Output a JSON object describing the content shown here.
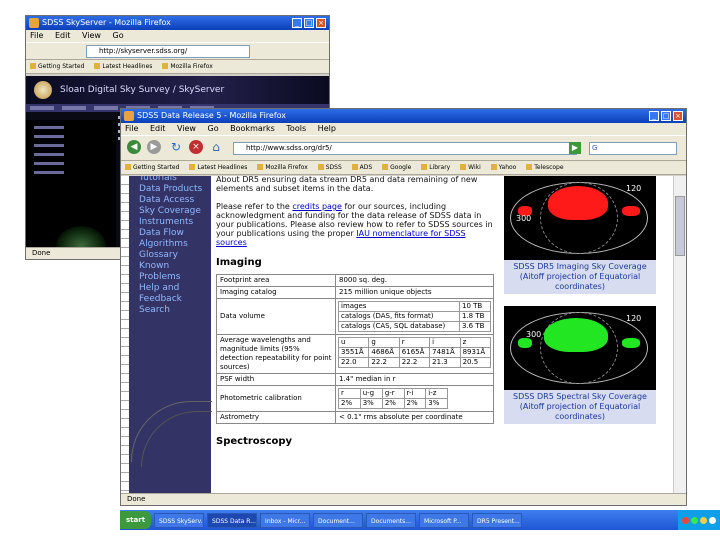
{
  "window_back": {
    "title": "SDSS SkyServer - Mozilla Firefox",
    "address": "http://skyserver.sdss.org/",
    "banner": "Sloan Digital Sky Survey / SkyServer"
  },
  "window_front": {
    "title": "SDSS Data Release 5 - Mozilla Firefox",
    "menu": [
      "File",
      "Edit",
      "View",
      "Go",
      "Bookmarks",
      "Tools",
      "Help"
    ],
    "address": "http://www.sdss.org/dr5/",
    "bookmarks": [
      "Getting Started",
      "Latest Headlines",
      "Mozilla Firefox",
      "SDSS",
      "ADS",
      "Google",
      "Library",
      "Wiki",
      "Yahoo",
      "Telescope"
    ],
    "status": "Done",
    "nav": [
      "Tutorials",
      "Data Products",
      "Data Access",
      "Sky Coverage",
      "Instruments",
      "Data Flow",
      "Algorithms",
      "Glossary",
      "Known Problems",
      "Help and Feedback",
      "Search"
    ],
    "intro_lines": [
      "About DR5 ensuring data stream DR5 and data remaining of new",
      "elements and subset items in the data."
    ],
    "credit_lines": [
      "Please refer to the",
      "credits page",
      "for our sources, including acknowledgment",
      "and funding for the data release of SDSS data in your",
      "publications. Please also review how to refer to SDSS sources in your",
      "publications using the proper",
      "IAU nomenclature for SDSS sources"
    ],
    "imaging_heading": "Imaging",
    "imaging_table": {
      "footprint_label": "Footprint area",
      "footprint_value": "8000 sq. deg.",
      "catalog_label": "Imaging catalog",
      "catalog_value": "215 million unique objects",
      "volume_label": "Data volume",
      "volume_rows": [
        {
          "name": "images",
          "value": "10 TB"
        },
        {
          "name": "catalogs (DAS, fits format)",
          "value": "1.8 TB"
        },
        {
          "name": "catalogs (CAS, SQL database)",
          "value": "3.6 TB"
        }
      ],
      "wavelength_label": "Average wavelengths and magnitude limits (95% detection repeatability for point sources)",
      "bands": [
        "u",
        "g",
        "r",
        "i",
        "z"
      ],
      "wavelengths": [
        "3551Å",
        "4686Å",
        "6165Å",
        "7481Å",
        "8931Å"
      ],
      "limits": [
        "22.0",
        "22.2",
        "22.2",
        "21.3",
        "20.5"
      ],
      "psf_label": "PSF width",
      "psf_value": "1.4\" median in r",
      "photometric_label": "Photometric calibration",
      "photometric_bands": [
        "r",
        "u-g",
        "g-r",
        "r-i",
        "i-z"
      ],
      "photometric_values": [
        "2%",
        "3%",
        "2%",
        "2%",
        "3%"
      ],
      "astrometry_label": "Astrometry",
      "astrometry_value": "< 0.1\" rms absolute per coordinate"
    },
    "spectroscopy_heading": "Spectroscopy",
    "caption_imaging": "SDSS DR5 Imaging Sky Coverage (Aitoff projection of Equatorial coordinates)",
    "caption_spectral": "SDSS DR5 Spectral Sky Coverage (Aitoff projection of Equatorial coordinates)",
    "map_ticks": [
      "300",
      "120"
    ],
    "colors": {
      "imaging_fill": "#ff1a1a",
      "spectral_fill": "#22e622",
      "nav_bg": "#333366",
      "caption_bg": "#d8dcf0"
    }
  },
  "taskbar": {
    "start": "start",
    "tasks": [
      "SDSS SkyServ...",
      "SDSS Data R...",
      "Inbox - Micr...",
      "Document...",
      "Documents...",
      "Microsoft P...",
      "DR5 Present..."
    ]
  },
  "icons": [
    "back-icon",
    "forward-icon",
    "reload-icon",
    "stop-icon",
    "home-icon",
    "go-icon",
    "search-icon",
    "close-icon",
    "minimize-icon",
    "maximize-icon"
  ]
}
